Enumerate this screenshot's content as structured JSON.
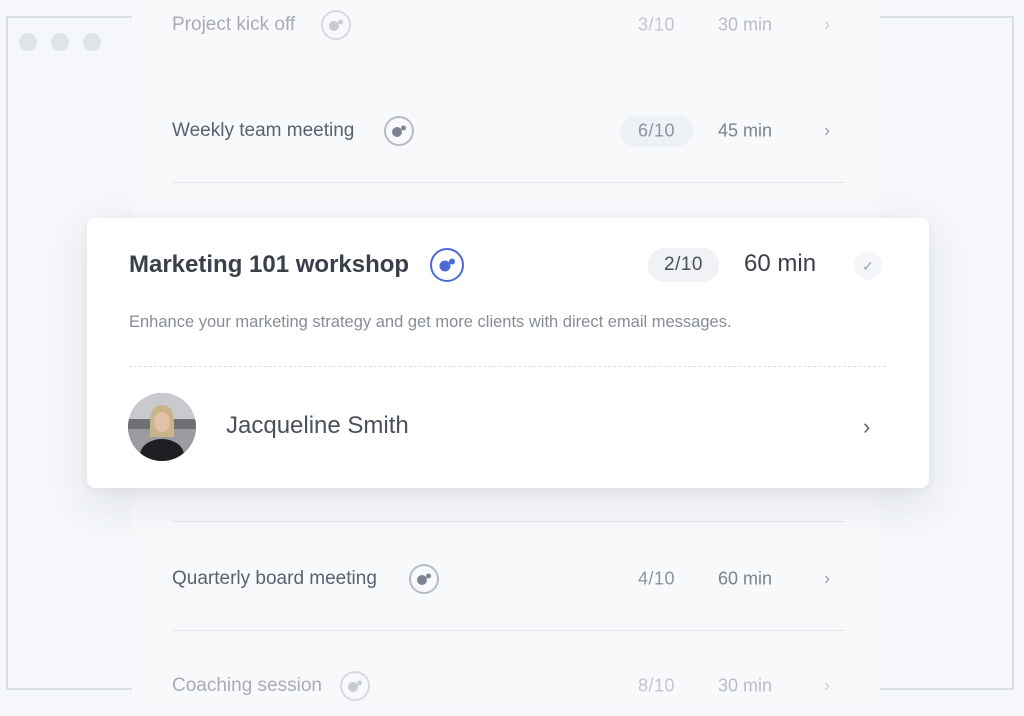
{
  "meetings_above": [
    {
      "title": "Project kick off",
      "count": "3/10",
      "duration": "30 min"
    },
    {
      "title": "Weekly team meeting",
      "count": "6/10",
      "duration": "45 min"
    }
  ],
  "active": {
    "title": "Marketing 101 workshop",
    "count": "2/10",
    "duration": "60 min",
    "description": "Enhance your marketing strategy and get more clients with direct email messages.",
    "host": "Jacqueline Smith",
    "accent_color": "#4d6bd6"
  },
  "meetings_below": [
    {
      "title": "Quarterly board meeting",
      "count": "4/10",
      "duration": "60 min"
    },
    {
      "title": "Coaching session",
      "count": "8/10",
      "duration": "30 min"
    }
  ],
  "icons": {
    "meeting": "meeting-icon",
    "check": "check-icon",
    "chevron": "chevron-right-icon"
  }
}
